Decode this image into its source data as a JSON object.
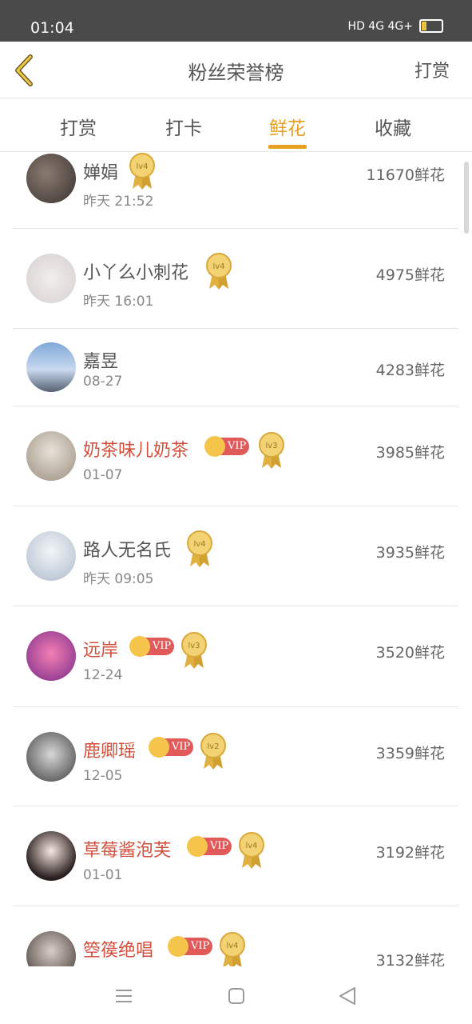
{
  "status_bar": {
    "time": "01:04",
    "indicators": "HD 4G 4G+"
  },
  "header": {
    "title": "粉丝荣誉榜",
    "action": "打赏"
  },
  "tabs": [
    {
      "label": "打赏",
      "active": false
    },
    {
      "label": "打卡",
      "active": false
    },
    {
      "label": "鲜花",
      "active": true
    },
    {
      "label": "收藏",
      "active": false
    }
  ],
  "fans": [
    {
      "name": "婵娟",
      "time": "昨天 21:52",
      "amount": "11670鲜花",
      "vip": false,
      "level": "lv4"
    },
    {
      "name": "小丫么小刺花",
      "time": "昨天 16:01",
      "amount": "4975鲜花",
      "vip": false,
      "level": "lv4"
    },
    {
      "name": "嘉昱",
      "time": "08-27",
      "amount": "4283鲜花",
      "vip": false,
      "level": ""
    },
    {
      "name": "奶茶味儿奶茶",
      "time": "01-07",
      "amount": "3985鲜花",
      "vip": true,
      "level": "lv3"
    },
    {
      "name": "路人无名氏",
      "time": "昨天 09:05",
      "amount": "3935鲜花",
      "vip": false,
      "level": "lv4"
    },
    {
      "name": "远岸",
      "time": "12-24",
      "amount": "3520鲜花",
      "vip": true,
      "level": "lv3"
    },
    {
      "name": "鹿卿瑶",
      "time": "12-05",
      "amount": "3359鲜花",
      "vip": true,
      "level": "lv2"
    },
    {
      "name": "草莓酱泡芙",
      "time": "01-01",
      "amount": "3192鲜花",
      "vip": true,
      "level": "lv4"
    },
    {
      "name": "箜篌绝唱",
      "time": "",
      "amount": "3132鲜花",
      "vip": true,
      "level": "lv4"
    }
  ],
  "vip_label": "VIP",
  "colors": {
    "accent": "#e8a020",
    "vip_name": "#d0503e",
    "vip_badge": "#e05a5a"
  },
  "icons": {
    "back": "chevron-left-icon",
    "nav": [
      "menu-icon",
      "home-square-icon",
      "back-triangle-icon"
    ]
  }
}
